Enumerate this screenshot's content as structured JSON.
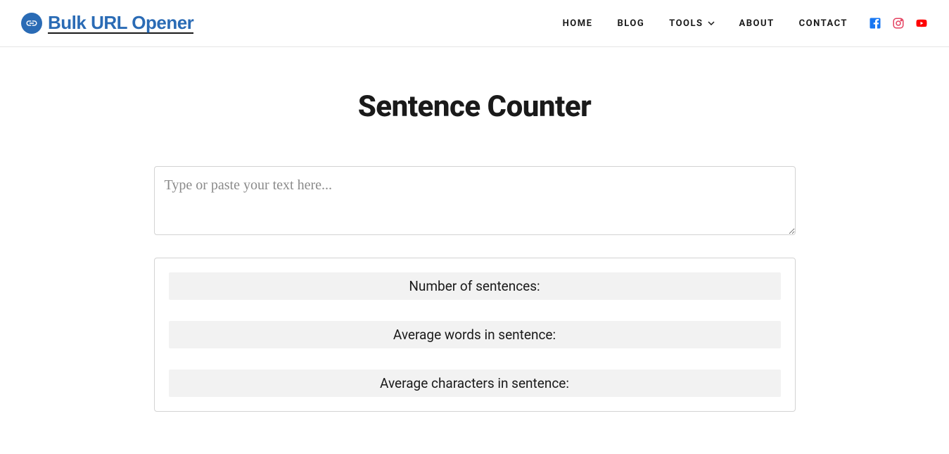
{
  "logo": {
    "text": "Bulk URL Opener"
  },
  "nav": {
    "items": [
      {
        "label": "HOME"
      },
      {
        "label": "BLOG"
      },
      {
        "label": "TOOLS",
        "has_dropdown": true
      },
      {
        "label": "ABOUT"
      },
      {
        "label": "CONTACT"
      }
    ]
  },
  "page": {
    "title": "Sentence Counter",
    "textarea_placeholder": "Type or paste your text here...",
    "textarea_value": ""
  },
  "stats": {
    "rows": [
      {
        "label": "Number of sentences:"
      },
      {
        "label": "Average words in sentence:"
      },
      {
        "label": "Average characters in sentence:"
      }
    ]
  },
  "social": {
    "facebook_color": "#1877f2",
    "instagram_color": "#e4405f",
    "youtube_color": "#ff0000"
  }
}
